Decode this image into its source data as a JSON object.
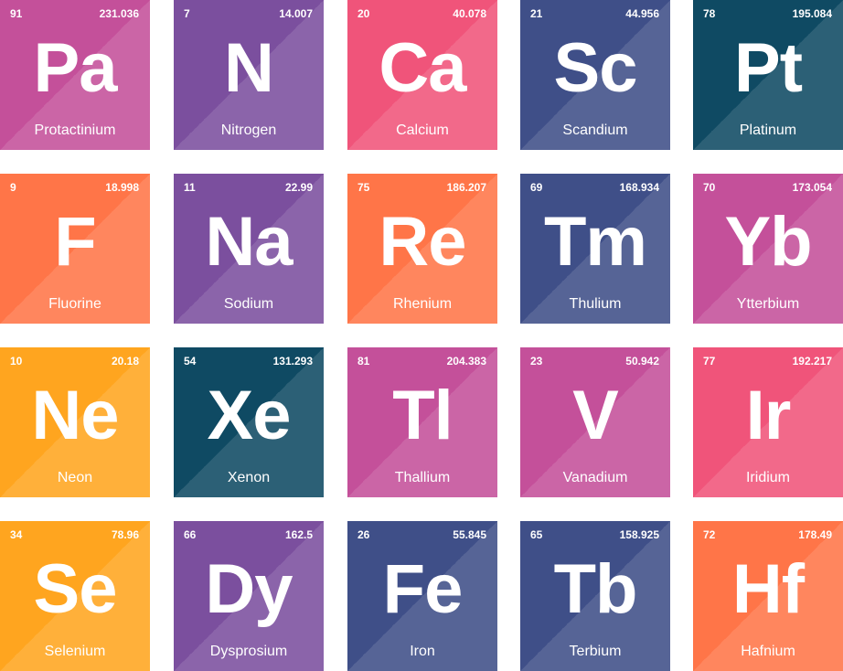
{
  "elements": [
    {
      "symbol": "Pa",
      "name": "Protactinium",
      "number": "91",
      "mass": "231.036",
      "color": "#c4509a"
    },
    {
      "symbol": "N",
      "name": "Nitrogen",
      "number": "7",
      "mass": "14.007",
      "color": "#7b4f9e"
    },
    {
      "symbol": "Ca",
      "name": "Calcium",
      "number": "20",
      "mass": "40.078",
      "color": "#f0547a"
    },
    {
      "symbol": "Sc",
      "name": "Scandium",
      "number": "21",
      "mass": "44.956",
      "color": "#3f4f88"
    },
    {
      "symbol": "Pt",
      "name": "Platinum",
      "number": "78",
      "mass": "195.084",
      "color": "#0f4a63"
    },
    {
      "symbol": "F",
      "name": "Fluorine",
      "number": "9",
      "mass": "18.998",
      "color": "#ff7548"
    },
    {
      "symbol": "Na",
      "name": "Sodium",
      "number": "11",
      "mass": "22.99",
      "color": "#7b4f9e"
    },
    {
      "symbol": "Re",
      "name": "Rhenium",
      "number": "75",
      "mass": "186.207",
      "color": "#ff7548"
    },
    {
      "symbol": "Tm",
      "name": "Thulium",
      "number": "69",
      "mass": "168.934",
      "color": "#3f4f88"
    },
    {
      "symbol": "Yb",
      "name": "Ytterbium",
      "number": "70",
      "mass": "173.054",
      "color": "#c4509a"
    },
    {
      "symbol": "Ne",
      "name": "Neon",
      "number": "10",
      "mass": "20.18",
      "color": "#ffa51f"
    },
    {
      "symbol": "Xe",
      "name": "Xenon",
      "number": "54",
      "mass": "131.293",
      "color": "#0f4a63"
    },
    {
      "symbol": "Tl",
      "name": "Thallium",
      "number": "81",
      "mass": "204.383",
      "color": "#c4509a"
    },
    {
      "symbol": "V",
      "name": "Vanadium",
      "number": "23",
      "mass": "50.942",
      "color": "#c4509a"
    },
    {
      "symbol": "Ir",
      "name": "Iridium",
      "number": "77",
      "mass": "192.217",
      "color": "#f0547a"
    },
    {
      "symbol": "Se",
      "name": "Selenium",
      "number": "34",
      "mass": "78.96",
      "color": "#ffa51f"
    },
    {
      "symbol": "Dy",
      "name": "Dysprosium",
      "number": "66",
      "mass": "162.5",
      "color": "#7b4f9e"
    },
    {
      "symbol": "Fe",
      "name": "Iron",
      "number": "26",
      "mass": "55.845",
      "color": "#3f4f88"
    },
    {
      "symbol": "Tb",
      "name": "Terbium",
      "number": "65",
      "mass": "158.925",
      "color": "#3f4f88"
    },
    {
      "symbol": "Hf",
      "name": "Hafnium",
      "number": "72",
      "mass": "178.49",
      "color": "#ff7548"
    }
  ]
}
